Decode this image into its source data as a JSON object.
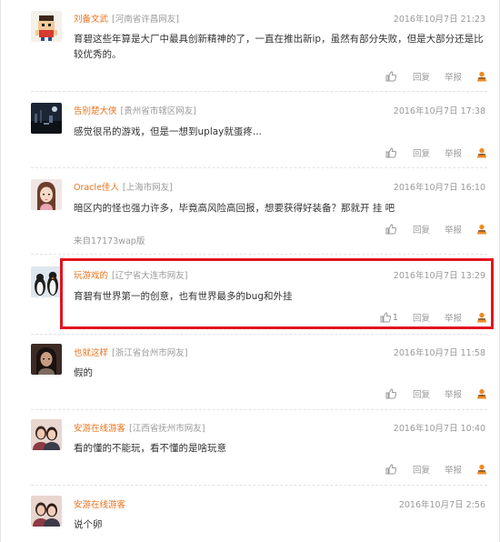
{
  "comments": [
    {
      "user": "刘备文武",
      "location": "[河南省许昌网友]",
      "time": "2016年10月7日 21:23",
      "text": "育碧这些年算是大厂中最具创新精神的了，一直在推出新ip，虽然有部分失败，但是大部分还是比较优秀的。",
      "source": "",
      "like_count": "",
      "avatar": "pixel-character"
    },
    {
      "user": "告别楚大侠",
      "location": "[贵州省市辖区网友]",
      "time": "2016年10月7日 17:38",
      "text": "感觉很吊的游戏，但是一想到uplay就蛋疼...",
      "source": "",
      "like_count": "",
      "avatar": "night-scene"
    },
    {
      "user": "Oracle佳人",
      "location": "[上海市网友]",
      "time": "2016年10月7日 16:10",
      "text": "暗区内的怪也强力许多，毕竟高风险高回报，想要获得好装备？那就开 挂 吧",
      "source": "来自17173wap版",
      "like_count": "",
      "avatar": "girl-portrait"
    },
    {
      "user": "玩游戏的",
      "location": "[辽宁省大连市网友]",
      "time": "2016年10月7日 13:29",
      "text": "育碧有世界第一的创意，也有世界最多的bug和外挂",
      "source": "",
      "like_count": "1",
      "avatar": "penguins"
    },
    {
      "user": "也就这样",
      "location": "[浙江省台州市网友]",
      "time": "2016年10月7日 11:58",
      "text": "假的",
      "source": "",
      "like_count": "",
      "avatar": "dark-portrait"
    },
    {
      "user": "安游在线游客",
      "location": "[江西省抚州市网友]",
      "time": "2016年10月7日 10:40",
      "text": "看的懂的不能玩，看不懂的是啥玩意",
      "source": "",
      "like_count": "",
      "avatar": "couple-photo"
    },
    {
      "user": "安游在线游客",
      "location": "",
      "time": "2016年10月7日 2:56",
      "text": "说个卵",
      "source": "",
      "like_count": "",
      "avatar": "couple-photo"
    }
  ],
  "actions": {
    "reply": "回复",
    "report": "举报"
  },
  "colors": {
    "username": "#e8731f",
    "meta": "#999999",
    "highlight": "#e2141f"
  }
}
